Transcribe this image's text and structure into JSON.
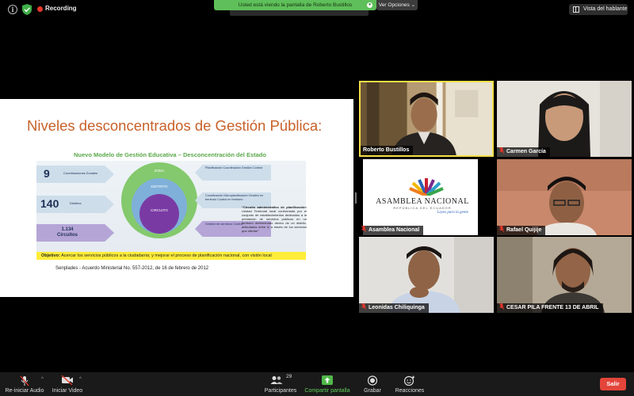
{
  "topbar": {
    "recording_label": "Recording",
    "share_banner": "Usted está viendo la pantalla de Roberto Bustillos",
    "view_options": "Ver Opciones",
    "view_options_caret": "⌄",
    "speaker_view": "Vista del hablante"
  },
  "slide": {
    "title": "Niveles desconcentrados de Gestión Pública:",
    "subtitle": "Nuevo Modelo de Gestión Educativa – Desconcentración del Estado",
    "levels": [
      {
        "number": "9",
        "label": "Coordinaciones Zonales"
      },
      {
        "number": "140",
        "label": "Distritos"
      },
      {
        "number": "1.134",
        "label": "Circuitos"
      }
    ],
    "circles": {
      "outer": "ZONA",
      "middle": "DISTRITO",
      "inner": "CIRCUITO"
    },
    "functions": [
      "Planificación Coordinación Gestión Control",
      "Coordinación Microplanificación Gestión en territorio Control en territorio",
      "Gestión de servicios Control"
    ],
    "definition_title": "“Circuito administrativo de planificación:",
    "definition_body": "Unidad Territorial local conformada por el conjunto de establecimientos dedicados a la prestación de servicios públicos en un territorio determinado dentro de un distrito, articulados entre sí a través de los servicios que ofertan”",
    "objective_label": "Objetivo:",
    "objective_text": "Acercar los servicios públicos a la ciudadanía; y mejorar el proceso de planificación nacional, con visión local",
    "source": "Senplades - Acuerdo Ministerial No. 557-2012, de 16 de febrero de 2012"
  },
  "participants": [
    {
      "name": "Roberto Bustillos",
      "muted": false
    },
    {
      "name": "Carmen García",
      "muted": true
    },
    {
      "name": "Asamblea Nacional",
      "muted": true
    },
    {
      "name": "Rafael Quijije",
      "muted": true
    },
    {
      "name": "Leonidas Chiliquinga",
      "muted": true
    },
    {
      "name": "CESAR PILA FRENTE 13 DE ABRIL",
      "muted": true
    }
  ],
  "logo": {
    "title": "ASAMBLEA NACIONAL",
    "subtitle": "REPÚBLICA DEL ECUADOR",
    "tagline": "Leyes para la gente"
  },
  "toolbar": {
    "audio_label": "Re-iniciar Audio",
    "video_label": "Iniciar Video",
    "caret": "^",
    "participants_label": "Participantes",
    "participants_count": "29",
    "share_label": "Compartir pantalla",
    "record_label": "Grabar",
    "reactions_label": "Reacciones",
    "leave_label": "Salir"
  },
  "colors": {
    "slide_title": "#c8612a",
    "slide_subtitle": "#5aa84a",
    "active_speaker_border": "#f5e04a",
    "share_banner": "#5fbf5a",
    "leave_button": "#e3453a",
    "recording_dot": "#e8362b"
  }
}
